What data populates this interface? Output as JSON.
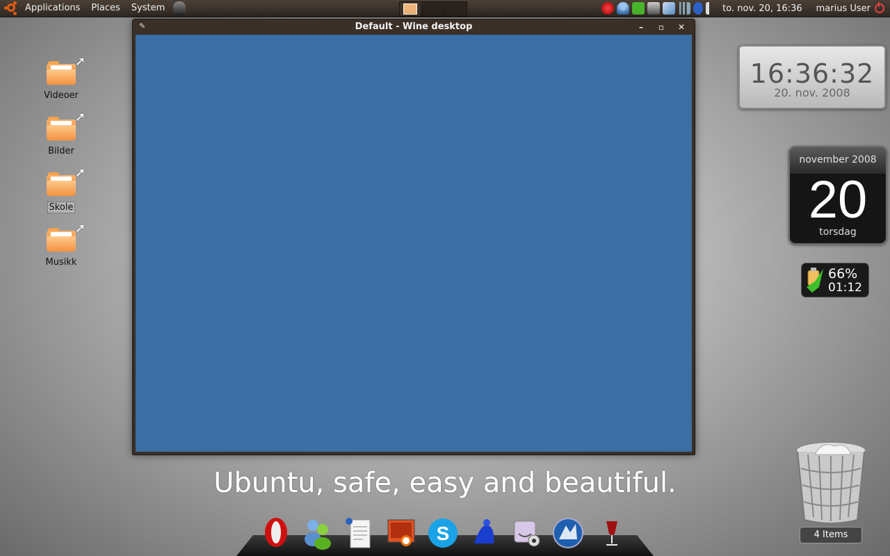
{
  "top_panel": {
    "menus": [
      "Applications",
      "Places",
      "System"
    ],
    "clock": "to. nov. 20, 16:36",
    "user": "marius User"
  },
  "desktop_icons": [
    {
      "label": "Videoer"
    },
    {
      "label": "Bilder"
    },
    {
      "label": "Skole"
    },
    {
      "label": "Musikk"
    }
  ],
  "wine_window": {
    "title": "Default - Wine desktop",
    "content_color": "#3a6ea5"
  },
  "clock_widget": {
    "time": "16:36:32",
    "date": "20. nov. 2008"
  },
  "calendar_widget": {
    "month": "november 2008",
    "day": "20",
    "weekday": "torsdag"
  },
  "battery_widget": {
    "percent": "66%",
    "time": "01:12"
  },
  "slogan": "Ubuntu, safe, easy and beautiful.",
  "dock": {
    "items": [
      "opera-icon",
      "messenger-icon",
      "text-editor-icon",
      "image-viewer-icon",
      "skype-icon",
      "frog-icon",
      "webcam-icon",
      "wolf-browser-icon",
      "wine-glass-icon"
    ]
  },
  "trash": {
    "label": "4 Items"
  },
  "colors": {
    "panel": "#3a3129",
    "ubuntu_orange": "#e25c12",
    "wine_blue": "#3a6ea5"
  }
}
